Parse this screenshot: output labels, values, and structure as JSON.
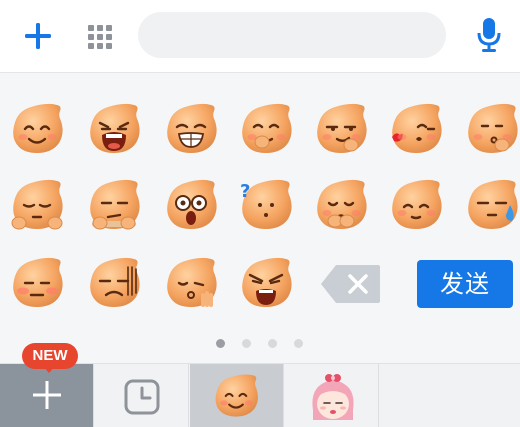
{
  "toolbar": {
    "add_icon": "plus-icon",
    "apps_icon": "grid-icon",
    "search_placeholder": "",
    "voice_icon": "microphone-icon",
    "accent": "#1677e6"
  },
  "emoji_panel": {
    "emojis": [
      {
        "name": "smile"
      },
      {
        "name": "crying-wail"
      },
      {
        "name": "grin"
      },
      {
        "name": "giggle-cover"
      },
      {
        "name": "smug"
      },
      {
        "name": "kiss"
      },
      {
        "name": "shy-think"
      },
      {
        "name": "sleepy"
      },
      {
        "name": "bored-peek"
      },
      {
        "name": "shocked"
      },
      {
        "name": "confused"
      },
      {
        "name": "pleading"
      },
      {
        "name": "blush"
      },
      {
        "name": "sweat"
      },
      {
        "name": "awkward"
      },
      {
        "name": "speechless"
      },
      {
        "name": "wave-hand"
      },
      {
        "name": "angry-shout"
      }
    ],
    "backspace_icon": "backspace-icon",
    "send_label": "发送",
    "pages": 4,
    "active_page": 0
  },
  "bottom_bar": {
    "badge_label": "NEW",
    "tabs": [
      {
        "name": "add-pack",
        "icon": "plus-icon",
        "selected": false
      },
      {
        "name": "recent",
        "icon": "clock-icon",
        "selected": false
      },
      {
        "name": "default-emoji",
        "icon": "emoji-icon",
        "selected": true
      },
      {
        "name": "girl-sticker",
        "icon": "girl-sticker-icon",
        "selected": false
      }
    ]
  }
}
